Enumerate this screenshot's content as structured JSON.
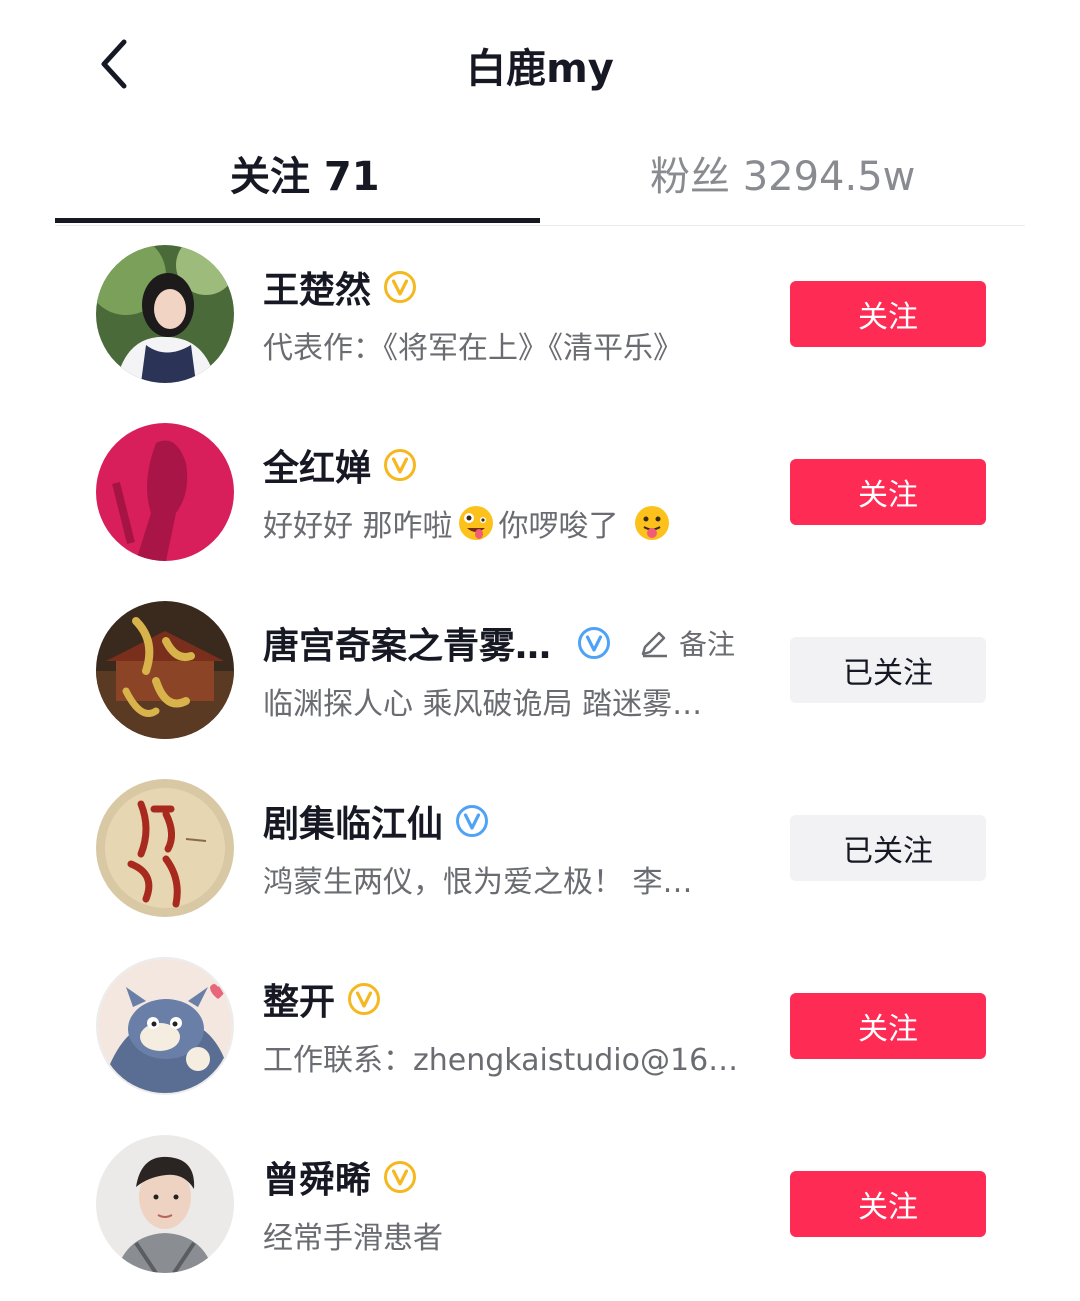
{
  "header": {
    "title": "白鹿my"
  },
  "tabs": [
    {
      "label": "关注 71"
    },
    {
      "label": "粉丝 3294.5w"
    }
  ],
  "users": [
    {
      "name": "王楚然",
      "badge": "yellow-verified-icon",
      "desc": "代表作：《将军在上》《清平乐》",
      "button": "关注",
      "following": false
    },
    {
      "name": "全红婵",
      "badge": "yellow-verified-icon",
      "desc_parts": [
        "好好好 那咋啦",
        "你啰唆了"
      ],
      "emojis": [
        "zany-face-emoji",
        "tongue-out-emoji"
      ],
      "button": "关注",
      "following": false
    },
    {
      "name": "唐宫奇案之青雾…",
      "badge": "blue-verified-icon",
      "remark": "备注",
      "desc": "临渊探人心 乘风破诡局 踏迷雾…",
      "button": "已关注",
      "following": true
    },
    {
      "name": "剧集临江仙",
      "badge": "blue-verified-icon",
      "desc": "鸿蒙生两仪，恨为爱之极！ 李…",
      "button": "已关注",
      "following": true
    },
    {
      "name": "整开",
      "badge": "yellow-verified-icon",
      "desc": "工作联系：zhengkaistudio@16…",
      "button": "关注",
      "following": false
    },
    {
      "name": "曾舜晞",
      "badge": "yellow-verified-icon",
      "desc": "经常手滑患者",
      "button": "关注",
      "following": false
    }
  ],
  "colors": {
    "accent": "#fe2c55",
    "text": "#161823",
    "secondary": "#6b6c72",
    "followed_bg": "#f2f2f4",
    "yellow_badge": "#f5b820",
    "blue_badge": "#4fa3f7"
  }
}
